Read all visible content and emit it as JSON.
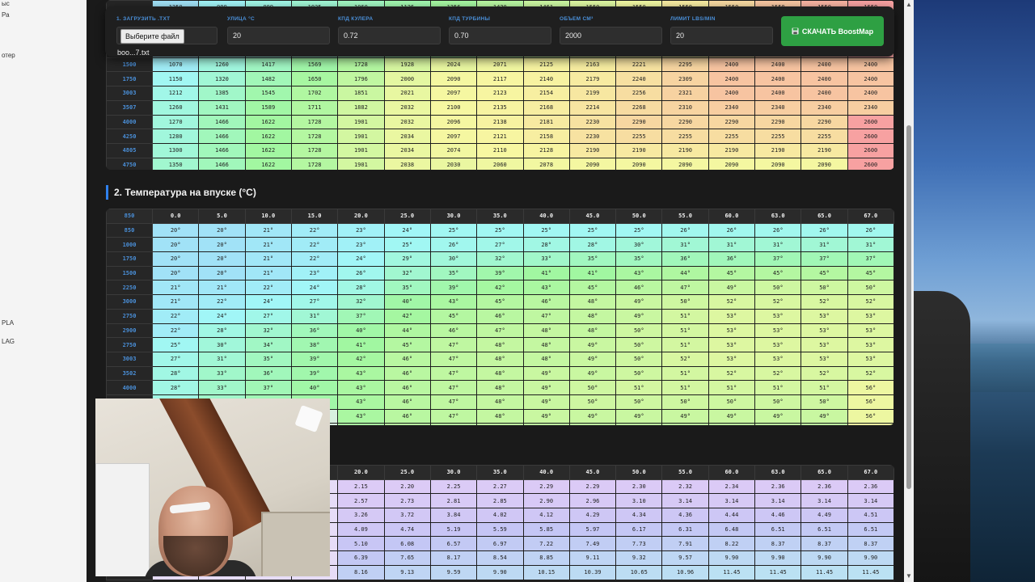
{
  "desktop_left": {
    "fragments": [
      "ыс",
      "Ра",
      "отер",
      "PLA",
      "LAG"
    ]
  },
  "toolbar": {
    "file": {
      "label": "1. ЗАГРУЗИТЬ .TXT",
      "button": "Выберите файл",
      "filename": "boo...7.txt"
    },
    "fields": [
      {
        "label": "УЛИЦА °C",
        "value": "20"
      },
      {
        "label": "КПД КУЛЕРА",
        "value": "0.72"
      },
      {
        "label": "КПД ТУРБИНЫ",
        "value": "0.70"
      },
      {
        "label": "ОБЪЕМ СМ³",
        "value": "2000"
      },
      {
        "label": "ЛИМИТ LBS/MIN",
        "value": "20"
      }
    ],
    "download_label": "СКАЧАТЬ BoostMap",
    "download_icon": "save-icon"
  },
  "table1": {
    "partial_row": [
      "1250",
      "999",
      "999",
      "1025",
      "1060",
      "1126",
      "1356",
      "1420",
      "1461",
      "1550",
      "1550",
      "1550",
      "1550",
      "1550",
      "1550",
      "1550"
    ],
    "rows": [
      {
        "rpm": "1500",
        "values": [
          "1070",
          "1260",
          "1417",
          "1569",
          "1728",
          "1928",
          "2024",
          "2071",
          "2125",
          "2163",
          "2221",
          "2295",
          "2400",
          "2400",
          "2400",
          "2400"
        ]
      },
      {
        "rpm": "1750",
        "values": [
          "1150",
          "1320",
          "1482",
          "1650",
          "1796",
          "2000",
          "2090",
          "2117",
          "2140",
          "2179",
          "2240",
          "2309",
          "2400",
          "2400",
          "2400",
          "2400"
        ]
      },
      {
        "rpm": "3003",
        "values": [
          "1212",
          "1385",
          "1545",
          "1702",
          "1851",
          "2021",
          "2097",
          "2123",
          "2154",
          "2199",
          "2256",
          "2321",
          "2400",
          "2400",
          "2400",
          "2400"
        ]
      },
      {
        "rpm": "3507",
        "values": [
          "1260",
          "1431",
          "1589",
          "1711",
          "1882",
          "2032",
          "2100",
          "2135",
          "2168",
          "2214",
          "2268",
          "2310",
          "2340",
          "2340",
          "2340",
          "2340"
        ]
      },
      {
        "rpm": "4000",
        "values": [
          "1270",
          "1466",
          "1622",
          "1728",
          "1901",
          "2032",
          "2096",
          "2138",
          "2181",
          "2230",
          "2290",
          "2290",
          "2290",
          "2290",
          "2290",
          "2600"
        ]
      },
      {
        "rpm": "4250",
        "values": [
          "1280",
          "1466",
          "1622",
          "1728",
          "1901",
          "2034",
          "2097",
          "2121",
          "2158",
          "2230",
          "2255",
          "2255",
          "2255",
          "2255",
          "2255",
          "2600"
        ]
      },
      {
        "rpm": "4805",
        "values": [
          "1300",
          "1466",
          "1622",
          "1728",
          "1901",
          "2034",
          "2074",
          "2110",
          "2128",
          "2190",
          "2190",
          "2190",
          "2190",
          "2190",
          "2190",
          "2600"
        ]
      },
      {
        "rpm": "4750",
        "values": [
          "1350",
          "1466",
          "1622",
          "1728",
          "1901",
          "2038",
          "2030",
          "2060",
          "2078",
          "2090",
          "2090",
          "2090",
          "2090",
          "2090",
          "2090",
          "2600"
        ]
      }
    ]
  },
  "section2": {
    "title": "2. Температура на впуске (°C)",
    "corner": "850",
    "headers": [
      "0.0",
      "5.0",
      "10.0",
      "15.0",
      "20.0",
      "25.0",
      "30.0",
      "35.0",
      "40.0",
      "45.0",
      "50.0",
      "55.0",
      "60.0",
      "63.0",
      "65.0",
      "67.0"
    ],
    "rows": [
      {
        "rpm": "850",
        "values": [
          "20°",
          "20°",
          "21°",
          "22°",
          "23°",
          "24°",
          "25°",
          "25°",
          "25°",
          "25°",
          "25°",
          "26°",
          "26°",
          "26°",
          "26°",
          "26°"
        ]
      },
      {
        "rpm": "1000",
        "values": [
          "20°",
          "20°",
          "21°",
          "22°",
          "23°",
          "25°",
          "26°",
          "27°",
          "28°",
          "28°",
          "30°",
          "31°",
          "31°",
          "31°",
          "31°",
          "31°"
        ]
      },
      {
        "rpm": "1750",
        "values": [
          "20°",
          "20°",
          "21°",
          "22°",
          "24°",
          "29°",
          "30°",
          "32°",
          "33°",
          "35°",
          "35°",
          "36°",
          "36°",
          "37°",
          "37°",
          "37°"
        ]
      },
      {
        "rpm": "1500",
        "values": [
          "20°",
          "20°",
          "21°",
          "23°",
          "26°",
          "32°",
          "35°",
          "39°",
          "41°",
          "41°",
          "43°",
          "44°",
          "45°",
          "45°",
          "45°",
          "45°"
        ]
      },
      {
        "rpm": "2250",
        "values": [
          "21°",
          "21°",
          "22°",
          "24°",
          "28°",
          "35°",
          "39°",
          "42°",
          "43°",
          "45°",
          "46°",
          "47°",
          "49°",
          "50°",
          "50°",
          "50°"
        ]
      },
      {
        "rpm": "3000",
        "values": [
          "21°",
          "22°",
          "24°",
          "27°",
          "32°",
          "40°",
          "43°",
          "45°",
          "46°",
          "48°",
          "49°",
          "50°",
          "52°",
          "52°",
          "52°",
          "52°"
        ]
      },
      {
        "rpm": "2750",
        "values": [
          "22°",
          "24°",
          "27°",
          "31°",
          "37°",
          "42°",
          "45°",
          "46°",
          "47°",
          "48°",
          "49°",
          "51°",
          "53°",
          "53°",
          "53°",
          "53°"
        ]
      },
      {
        "rpm": "2900",
        "values": [
          "22°",
          "28°",
          "32°",
          "36°",
          "40°",
          "44°",
          "46°",
          "47°",
          "48°",
          "48°",
          "50°",
          "51°",
          "53°",
          "53°",
          "53°",
          "53°"
        ]
      },
      {
        "rpm": "2750",
        "values": [
          "25°",
          "30°",
          "34°",
          "38°",
          "41°",
          "45°",
          "47°",
          "48°",
          "48°",
          "49°",
          "50°",
          "51°",
          "53°",
          "53°",
          "53°",
          "53°"
        ]
      },
      {
        "rpm": "3003",
        "values": [
          "27°",
          "31°",
          "35°",
          "39°",
          "42°",
          "46°",
          "47°",
          "48°",
          "48°",
          "49°",
          "50°",
          "52°",
          "53°",
          "53°",
          "53°",
          "53°"
        ]
      },
      {
        "rpm": "3502",
        "values": [
          "28°",
          "33°",
          "36°",
          "39°",
          "43°",
          "46°",
          "47°",
          "48°",
          "49°",
          "49°",
          "50°",
          "51°",
          "52°",
          "52°",
          "52°",
          "52°"
        ]
      },
      {
        "rpm": "4000",
        "values": [
          "28°",
          "33°",
          "37°",
          "40°",
          "43°",
          "46°",
          "47°",
          "48°",
          "49°",
          "50°",
          "51°",
          "51°",
          "51°",
          "51°",
          "51°",
          "56°"
        ]
      },
      {
        "rpm": "4250",
        "values": [
          "28°",
          "33°",
          "37°",
          "40°",
          "43°",
          "46°",
          "47°",
          "48°",
          "49°",
          "50°",
          "50°",
          "50°",
          "50°",
          "50°",
          "50°",
          "56°"
        ]
      },
      {
        "rpm": "",
        "values": [
          "",
          "",
          "",
          "",
          "43°",
          "46°",
          "47°",
          "48°",
          "49°",
          "49°",
          "49°",
          "49°",
          "49°",
          "49°",
          "49°",
          "56°"
        ]
      },
      {
        "rpm": "",
        "values": [
          "",
          "",
          "",
          "",
          "43°",
          "46°",
          "46°",
          "47°",
          "47°",
          "47°",
          "47°",
          "47°",
          "47°",
          "47°",
          "47°",
          "56°"
        ]
      }
    ]
  },
  "section3": {
    "headers": [
      "20.0",
      "25.0",
      "30.0",
      "35.0",
      "40.0",
      "45.0",
      "50.0",
      "55.0",
      "60.0",
      "63.0",
      "65.0",
      "67.0"
    ],
    "rows": [
      [
        "2.15",
        "2.20",
        "2.25",
        "2.27",
        "2.29",
        "2.29",
        "2.30",
        "2.32",
        "2.34",
        "2.36",
        "2.36",
        "2.36"
      ],
      [
        "2.57",
        "2.73",
        "2.81",
        "2.85",
        "2.90",
        "2.96",
        "3.10",
        "3.14",
        "3.14",
        "3.14",
        "3.14",
        "3.14"
      ],
      [
        "3.26",
        "3.72",
        "3.84",
        "4.02",
        "4.12",
        "4.29",
        "4.34",
        "4.36",
        "4.44",
        "4.46",
        "4.49",
        "4.51"
      ],
      [
        "4.09",
        "4.74",
        "5.19",
        "5.59",
        "5.85",
        "5.97",
        "6.17",
        "6.31",
        "6.48",
        "6.51",
        "6.51",
        "6.51"
      ],
      [
        "5.10",
        "6.08",
        "6.57",
        "6.97",
        "7.22",
        "7.49",
        "7.73",
        "7.91",
        "8.22",
        "8.37",
        "8.37",
        "8.37"
      ],
      [
        "6.39",
        "7.65",
        "8.17",
        "8.54",
        "8.85",
        "9.11",
        "9.32",
        "9.57",
        "9.90",
        "9.90",
        "9.90",
        "9.90"
      ],
      [
        "8.16",
        "9.13",
        "9.59",
        "9.90",
        "10.15",
        "10.39",
        "10.65",
        "10.96",
        "11.45",
        "11.45",
        "11.45",
        "11.45"
      ]
    ]
  },
  "colors": {
    "accent": "#2f80ed",
    "download": "#2ea043",
    "panel": "#222222"
  }
}
